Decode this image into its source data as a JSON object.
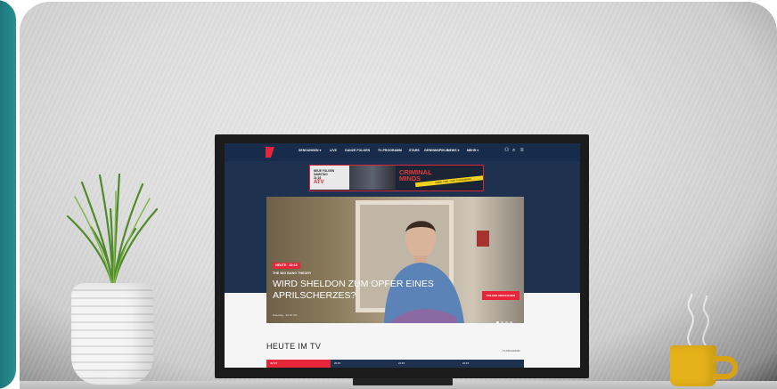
{
  "nav": {
    "items": [
      "SENDUNGEN ▾",
      "LIVE",
      "GANZE FOLGEN",
      "TV-PROGRAMM",
      "STARS",
      "GEWINNSPIELE",
      "NEWS ▾",
      "MEHR ▾"
    ]
  },
  "ad": {
    "tagline": "NEUE FOLGEN\nSAMSTAG\n21:15",
    "logo": "ATV",
    "title": "CRIMINAL\nMINDS",
    "tape_text": "CRIME TIME · DAS TV-PREMIERE"
  },
  "hero": {
    "kicker": "HEUTE · 20:15",
    "show": "THE BIG BANG THEORY",
    "headline": "WIRD SHELDON ZUM OPFER EINES\nAPRILSCHERZES?",
    "meta": "Dienstag · 20:15 Uhr",
    "cta": "FOLGEN ANSCHAUEN"
  },
  "section": {
    "title": "HEUTE IM TV",
    "link": "TV-PROGRAMM"
  },
  "schedule": [
    "JETZT",
    "20:15",
    "21:15",
    "22:15"
  ],
  "colors": {
    "brand": "#e8263a",
    "navy": "#172c4a",
    "band": "#1e3250"
  }
}
